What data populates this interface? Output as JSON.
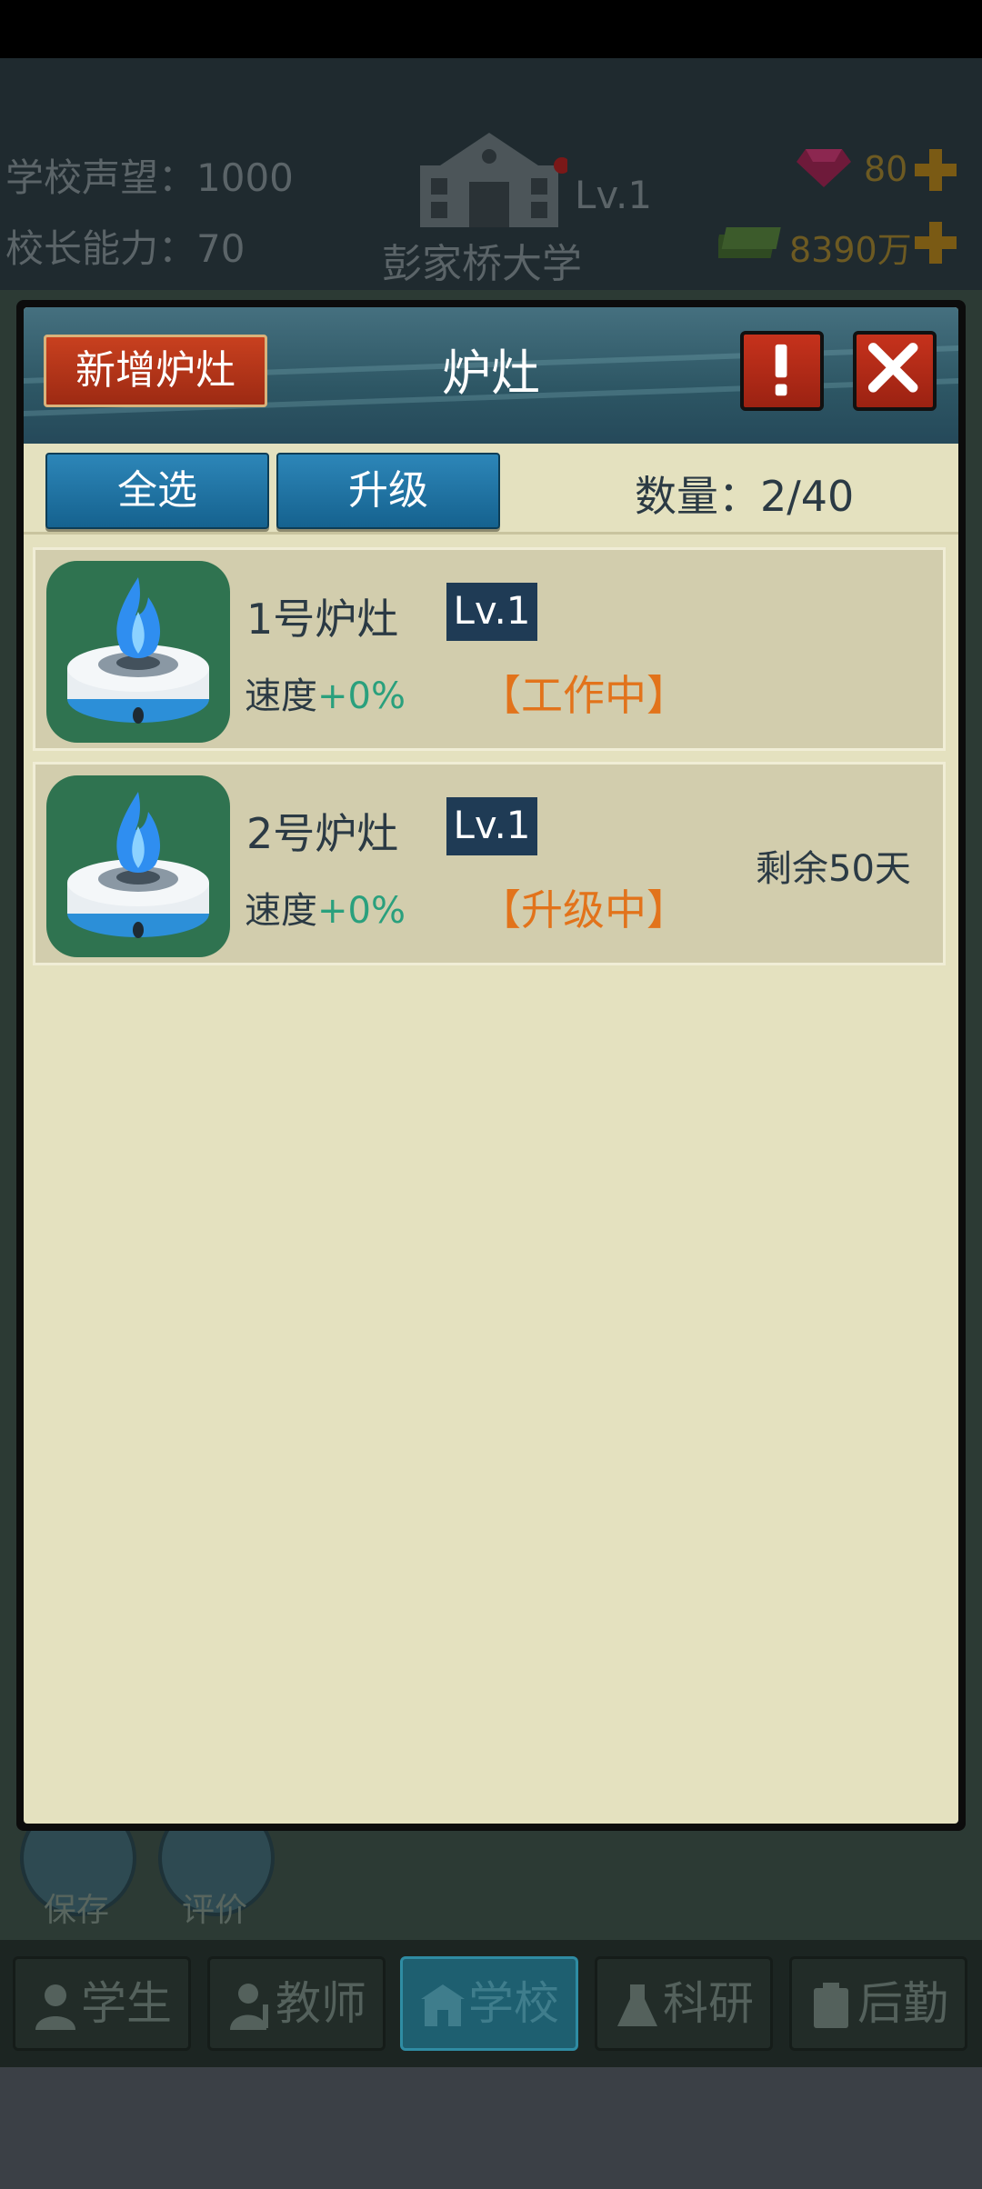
{
  "header": {
    "reputation_label": "学校声望：",
    "reputation_value": "1000",
    "principal_label": "校长能力：",
    "principal_value": "70",
    "school_level": "Lv.1",
    "school_name": "彭家桥大学",
    "gems": "80",
    "money": "8390万"
  },
  "side_buttons": {
    "save": "保存",
    "rate": "评价"
  },
  "dialog": {
    "title": "炉灶",
    "add_button": "新增炉灶",
    "select_all": "全选",
    "upgrade": "升级",
    "count_label": "数量：",
    "count_value": "2/40"
  },
  "stoves": [
    {
      "name": "1号炉灶",
      "level": "Lv.1",
      "speed_label": "速度",
      "speed_value": "+0%",
      "status": "【工作中】",
      "remaining": ""
    },
    {
      "name": "2号炉灶",
      "level": "Lv.1",
      "speed_label": "速度",
      "speed_value": "+0%",
      "status": "【升级中】",
      "remaining": "剩余50天"
    }
  ],
  "nav": {
    "students": "学生",
    "teachers": "教师",
    "school": "学校",
    "research": "科研",
    "logistics": "后勤"
  },
  "colors": {
    "title_bar": "#2d5664",
    "panel": "#e4e1bf",
    "button_blue": "#15628f",
    "button_red": "#c6321c",
    "status_orange": "#e2731b",
    "speed_green": "#2aa07d",
    "level_badge": "#1f3b55"
  }
}
